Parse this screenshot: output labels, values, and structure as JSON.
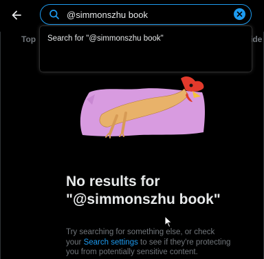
{
  "search": {
    "query": "@simmonszhu book",
    "suggestion": "Search for \"@simmonszhu book\""
  },
  "tabs": {
    "top": "Top",
    "video_partial": "ide"
  },
  "empty_state": {
    "title": "No results for \"@simmonszhu book\"",
    "subtitle_before": "Try searching for something else, or check your ",
    "link": "Search settings",
    "subtitle_after": " to see if they're protecting you from potentially sensitive content."
  },
  "icons": [
    "back-arrow-icon",
    "search-icon",
    "clear-icon",
    "rubber-chicken-illustration",
    "cursor-icon"
  ],
  "colors": {
    "accent": "#1d9bf0",
    "background": "#000000",
    "text": "#e7e9ea",
    "muted": "#71767b",
    "pink": "#d89be0"
  }
}
